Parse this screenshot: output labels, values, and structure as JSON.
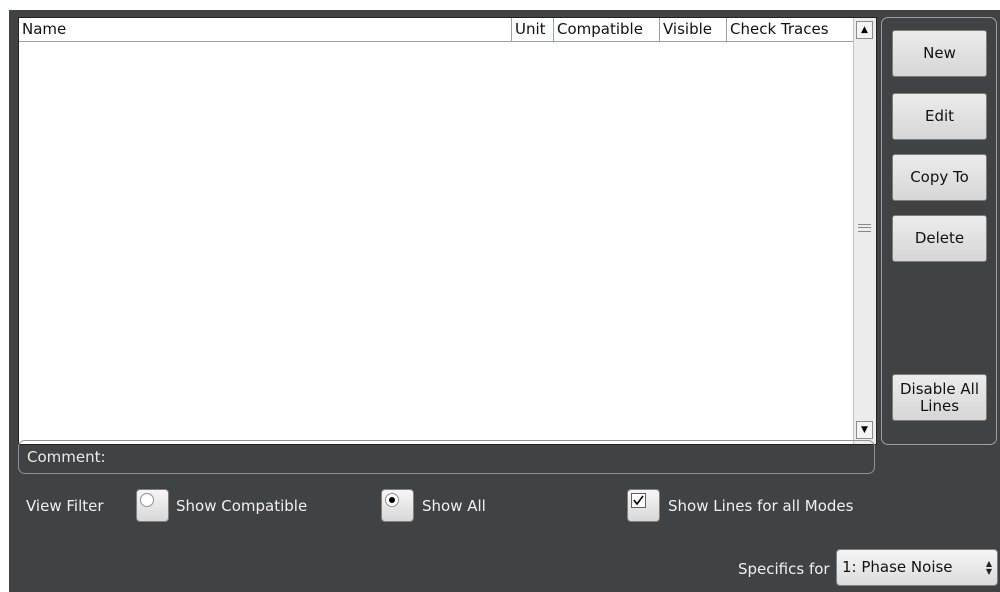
{
  "table": {
    "columns": [
      "Name",
      "Unit",
      "Compatible",
      "Visible",
      "Check Traces"
    ],
    "rows": []
  },
  "buttons": {
    "new": "New",
    "edit": "Edit",
    "copy_to": "Copy To",
    "delete": "Delete",
    "disable_all_line1": "Disable All",
    "disable_all_line2": "Lines"
  },
  "comment": {
    "label": "Comment:"
  },
  "view_filter": {
    "label": "View Filter",
    "show_compatible": {
      "label": "Show Compatible",
      "selected": false
    },
    "show_all": {
      "label": "Show All",
      "selected": true
    },
    "show_lines_all_modes": {
      "label": "Show Lines for all Modes",
      "checked": true
    }
  },
  "specifics": {
    "label": "Specifics for",
    "selected": "1: Phase Noise"
  },
  "icons": {
    "scroll_up": "scroll-up-arrow-icon",
    "scroll_down": "scroll-down-arrow-icon",
    "select_spinner": "up-down-chevron-icon"
  }
}
